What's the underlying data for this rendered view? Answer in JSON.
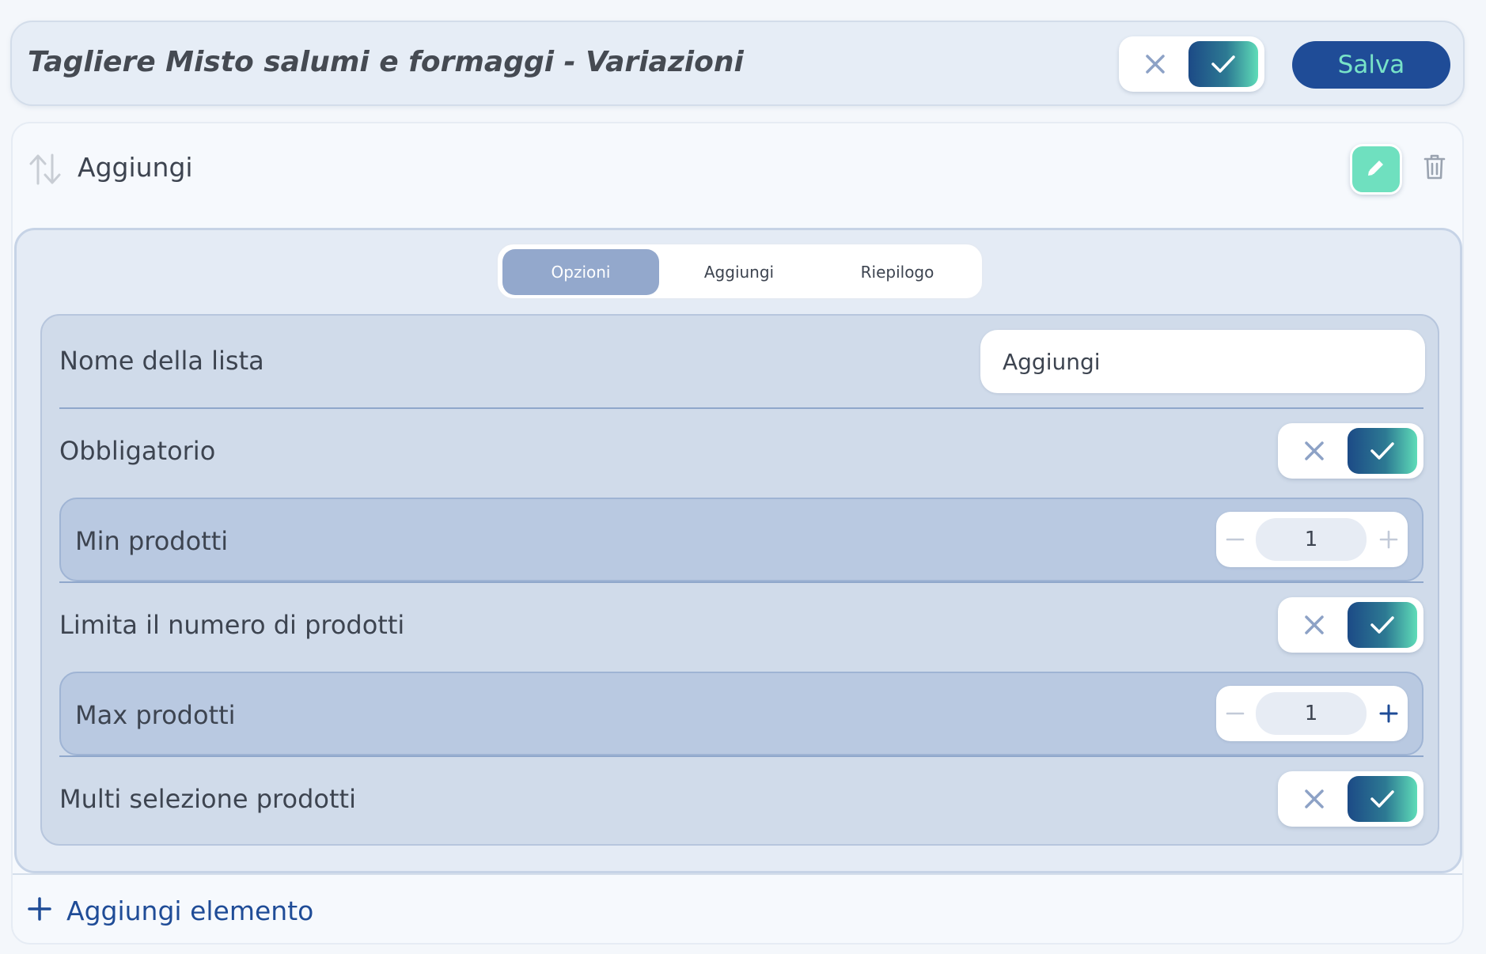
{
  "header": {
    "title": "Tagliere Misto salumi e formaggi - Variazioni",
    "save_label": "Salva",
    "active_toggle": true
  },
  "section": {
    "title": "Aggiungi",
    "icons": [
      "sort-icon",
      "edit-icon",
      "trash-icon"
    ]
  },
  "tabs": [
    {
      "label": "Opzioni",
      "active": true
    },
    {
      "label": "Aggiungi",
      "active": false
    },
    {
      "label": "Riepilogo",
      "active": false
    }
  ],
  "options": {
    "list_name_label": "Nome della lista",
    "list_name_value": "Aggiungi",
    "mandatory_label": "Obbligatorio",
    "mandatory_on": true,
    "min_label": "Min prodotti",
    "min_value": "1",
    "limit_label": "Limita il numero di prodotti",
    "limit_on": true,
    "max_label": "Max prodotti",
    "max_value": "1",
    "multi_label": "Multi selezione prodotti",
    "multi_on": true
  },
  "footer": {
    "add_element_label": "Aggiungi elemento"
  },
  "colors": {
    "primary": "#1f4c97",
    "accent": "#6fe0bf",
    "panel": "#d0dbea"
  }
}
